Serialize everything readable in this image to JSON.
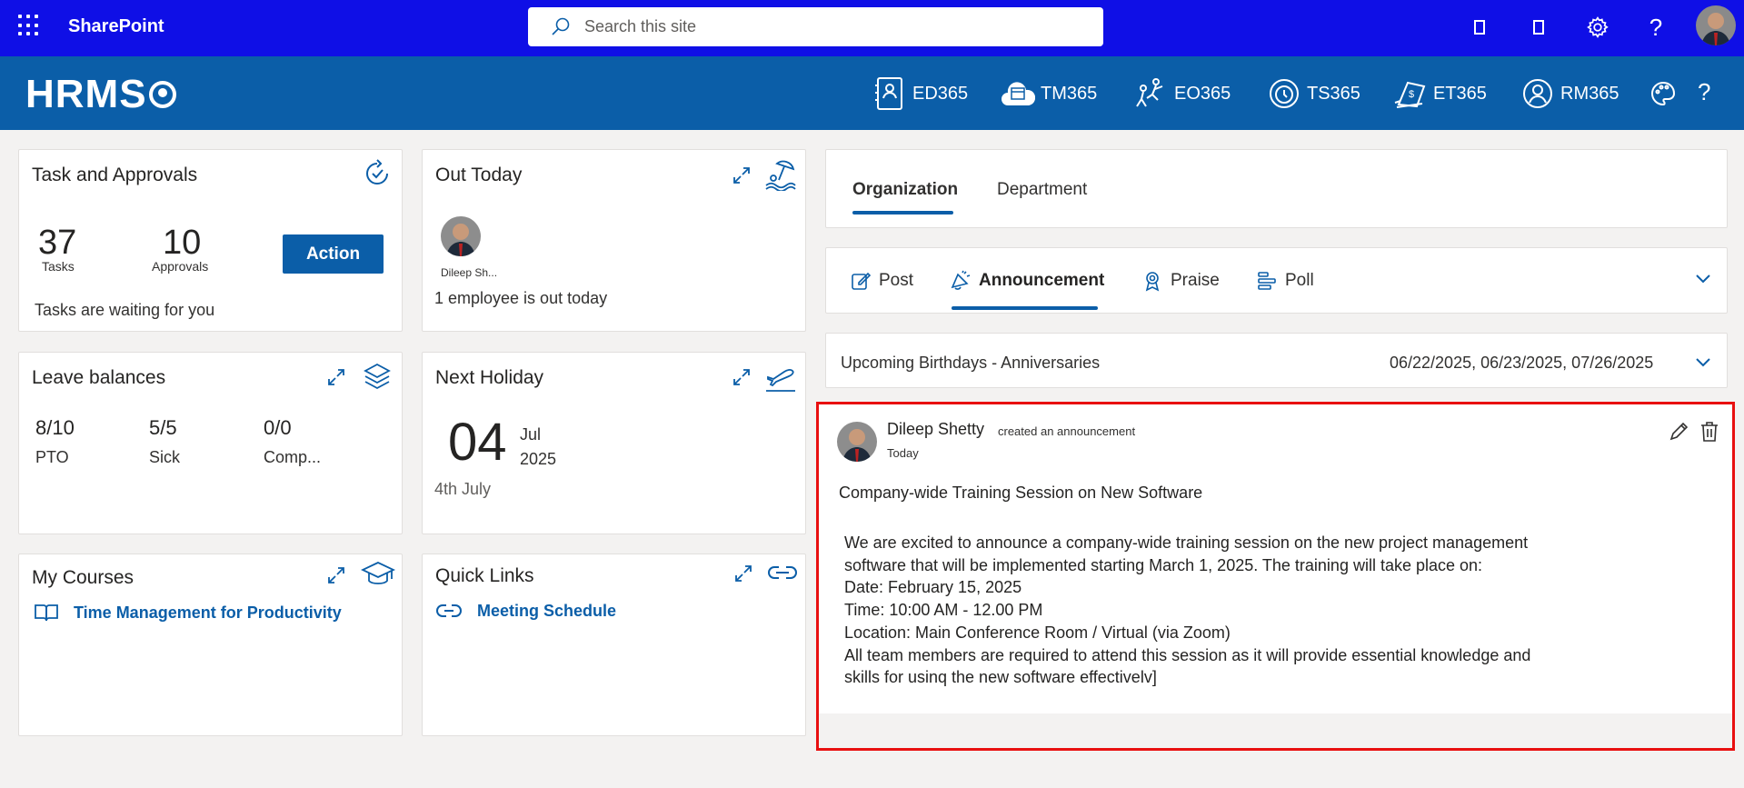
{
  "suite_bar": {
    "app_name": "SharePoint",
    "search_placeholder": "Search this site"
  },
  "hrms": {
    "logo": "HRMS",
    "modules": [
      "ED365",
      "TM365",
      "EO365",
      "TS365",
      "ET365",
      "RM365"
    ]
  },
  "tasks": {
    "title": "Task and Approvals",
    "tasks_count": "37",
    "tasks_label": "Tasks",
    "approvals_count": "10",
    "approvals_label": "Approvals",
    "action_label": "Action",
    "footer": "Tasks are waiting for you"
  },
  "out_today": {
    "title": "Out Today",
    "person_name": "Dileep Sh...",
    "summary": "1 employee is out today"
  },
  "leave": {
    "title": "Leave balances",
    "items": [
      {
        "value": "8/10",
        "label": "PTO"
      },
      {
        "value": "5/5",
        "label": "Sick"
      },
      {
        "value": "0/0",
        "label": "Comp..."
      }
    ]
  },
  "holiday": {
    "title": "Next Holiday",
    "day": "04",
    "month": "Jul",
    "year": "2025",
    "name": "4th July"
  },
  "courses": {
    "title": "My Courses",
    "items": [
      "Time Management for Productivity"
    ]
  },
  "quick_links": {
    "title": "Quick Links",
    "items": [
      "Meeting Schedule"
    ]
  },
  "scope_tabs": {
    "organization": "Organization",
    "department": "Department"
  },
  "post_tabs": {
    "post": "Post",
    "announcement": "Announcement",
    "praise": "Praise",
    "poll": "Poll"
  },
  "birthdays": {
    "label": "Upcoming Birthdays - Anniversaries",
    "dates": "06/22/2025, 06/23/2025, 07/26/2025"
  },
  "announcement": {
    "author": "Dileep Shetty",
    "action": "created an announcement",
    "time": "Today",
    "title": "Company-wide Training Session on New Software",
    "lines": [
      "We are excited to announce a company-wide training session on the new project management",
      "software that will be implemented starting March 1, 2025. The training will take place on:",
      "Date: February 15, 2025",
      "Time: 10:00 AM - 12.00 PM",
      "Location: Main Conference Room / Virtual (via Zoom)",
      "All team members are required to attend this session as it will provide essential knowledge and",
      "skills for usinq the new software effectivelv]"
    ]
  },
  "colors": {
    "suite_bar": "#0f0fe6",
    "brand": "#0b5ea8",
    "highlight_border": "#e81010"
  }
}
